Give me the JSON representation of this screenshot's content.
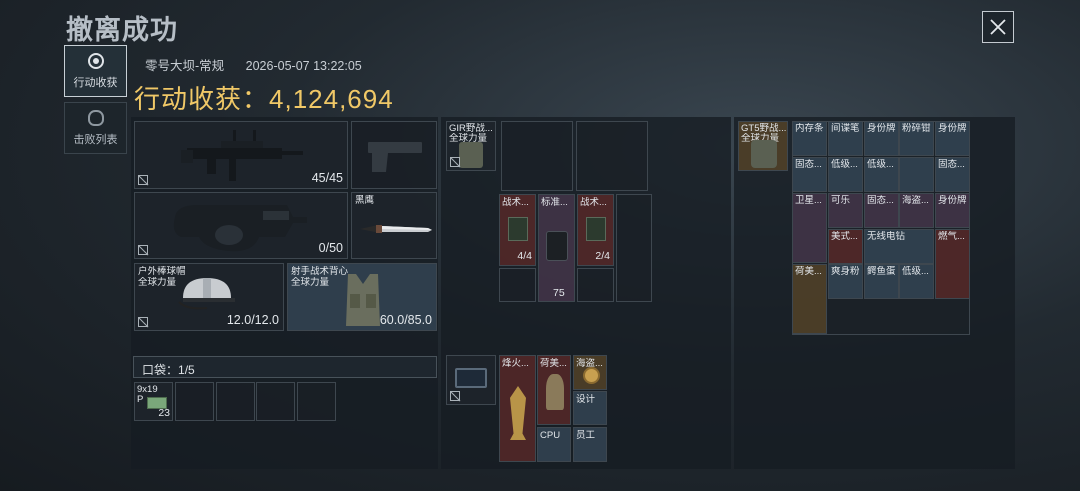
{
  "title": "撤离成功",
  "close": "×",
  "tabs": [
    {
      "label": "行动收获",
      "icon": "target-icon",
      "active": true
    },
    {
      "label": "击败列表",
      "icon": "skull-icon",
      "active": false
    }
  ],
  "meta": {
    "map": "零号大坝-常规",
    "time": "2026-05-07 13:22:05"
  },
  "harvest": {
    "label": "行动收获：",
    "value": "4,124,694"
  },
  "gear": {
    "primary": {
      "count": "45/45",
      "icon": "rifle-icon"
    },
    "pistol": {
      "icon": "pistol-icon"
    },
    "secondary": {
      "count": "0/50",
      "icon": "p90-icon"
    },
    "melee": {
      "name": "黑鹰",
      "icon": "knife-icon"
    },
    "helmet": {
      "name": "户外棒球帽",
      "brand": "全球力量",
      "count": "12.0/12.0"
    },
    "armor": {
      "name": "射手战术背心",
      "brand": "全球力量",
      "count": "60.0/85.0"
    }
  },
  "pocket": {
    "label": "口袋：",
    "count": "1/5",
    "ammo": {
      "name": "9x19",
      "sub": "P",
      "qty": "23"
    }
  },
  "rig": {
    "name": "GIR野战...",
    "brand": "全球力量",
    "items": [
      {
        "name": "战术...",
        "count": "4/4"
      },
      {
        "name": "标准...",
        "count": "75"
      },
      {
        "name": "战术...",
        "count": "2/4"
      }
    ]
  },
  "bag": {
    "items": [
      {
        "name": "烽火..."
      },
      {
        "name": "荷美..."
      },
      {
        "name": "海盗..."
      },
      {
        "name": "设计"
      },
      {
        "name": "CPU"
      },
      {
        "name": "员工"
      }
    ]
  },
  "backpack": {
    "name": "GT5野战...",
    "brand": "全球力量",
    "items": [
      "内存条",
      "间谍笔",
      "身份牌",
      "粉碎钳",
      "身份牌",
      "固态...",
      "低级...",
      "低级...",
      "",
      "固态...",
      "卫星...",
      "可乐",
      "固态...",
      "海盗...",
      "身份牌",
      "美式...",
      "无线电钻",
      "燃气...",
      "荷美...",
      "爽身粉",
      "鳄鱼蛋",
      "低级..."
    ]
  }
}
